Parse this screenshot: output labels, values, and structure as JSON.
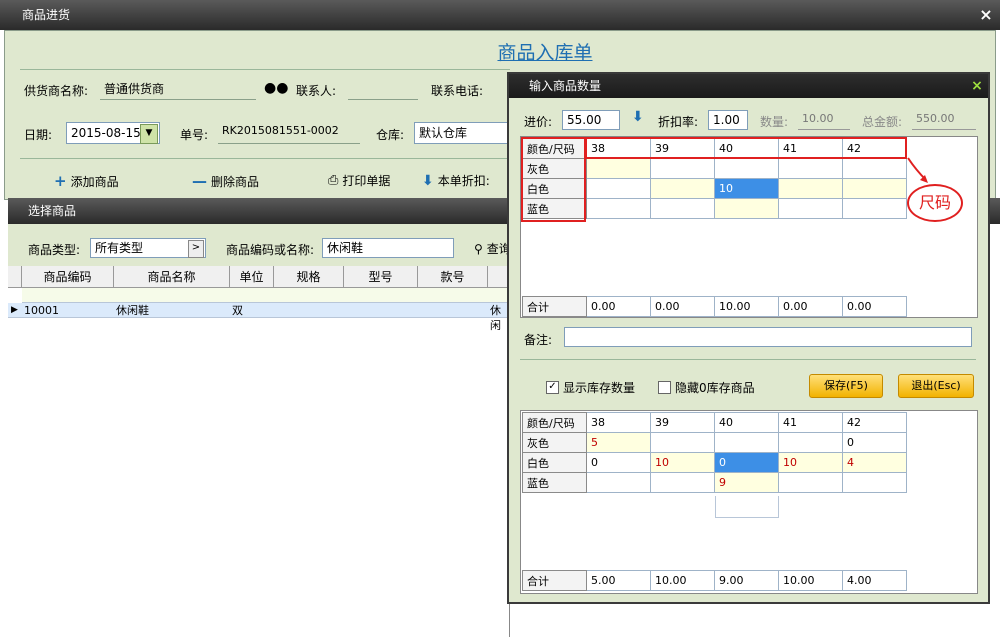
{
  "main_window": {
    "title": "商品进货",
    "close": "×",
    "form_title": "商品入库单",
    "supplier_label": "供货商名称:",
    "supplier_value": "普通供货商",
    "contact_label": "联系人:",
    "contact_value": "",
    "phone_label": "联系电话:",
    "date_label": "日期:",
    "date_value": "2015-08-15",
    "order_no_label": "单号:",
    "order_no_value": "RK2015081551-0002",
    "warehouse_label": "仓库:",
    "warehouse_value": "默认仓库",
    "toolbar": {
      "add": "添加商品",
      "delete": "删除商品",
      "print": "打印单据",
      "discount": "本单折扣:"
    }
  },
  "select_window": {
    "title": "选择商品",
    "type_label": "商品类型:",
    "type_value": "所有类型",
    "code_label": "商品编码或名称:",
    "code_value": "休闲鞋",
    "search": "查询",
    "columns": [
      "商品编码",
      "商品名称",
      "单位",
      "规格",
      "型号",
      "款号"
    ],
    "rows": [
      {
        "code": "10001",
        "name": "休闲鞋",
        "unit": "双",
        "spec": "",
        "model": "",
        "style": "",
        "extra": "休闲"
      }
    ]
  },
  "qty_dialog": {
    "title": "输入商品数量",
    "close": "×",
    "price_label": "进价:",
    "price_value": "55.00",
    "discount_label": "折扣率:",
    "discount_value": "1.00",
    "qty_label": "数量:",
    "qty_value": "10.00",
    "total_label": "总金额:",
    "total_value": "550.00",
    "grid_header": "颜色/尺码",
    "sizes": [
      "38",
      "39",
      "40",
      "41",
      "42"
    ],
    "colors": [
      "灰色",
      "白色",
      "蓝色"
    ],
    "input_cells": [
      [
        "",
        "",
        "",
        "",
        ""
      ],
      [
        "",
        "",
        "10",
        "",
        ""
      ],
      [
        "",
        "",
        "",
        "",
        ""
      ]
    ],
    "sum_label": "合计",
    "input_sums": [
      "0.00",
      "0.00",
      "10.00",
      "0.00",
      "0.00"
    ],
    "remark_label": "备注:",
    "show_stock_label": "显示库存数量",
    "hide_zero_label": "隐藏0库存商品",
    "save_label": "保存(F5)",
    "exit_label": "退出(Esc)",
    "stock_cells": [
      [
        "5",
        "",
        "",
        "",
        "0"
      ],
      [
        "0",
        "10",
        "0",
        "10",
        "4"
      ],
      [
        "",
        "",
        "9",
        "",
        ""
      ]
    ],
    "stock_sums": [
      "5.00",
      "10.00",
      "9.00",
      "10.00",
      "4.00"
    ],
    "annotation": "尺码"
  },
  "colors": {
    "accent_blue": "#1f6fb2",
    "form_green": "#dfe8cf",
    "highlight_red": "#e02020",
    "selected_cell": "#3d8fe6"
  }
}
